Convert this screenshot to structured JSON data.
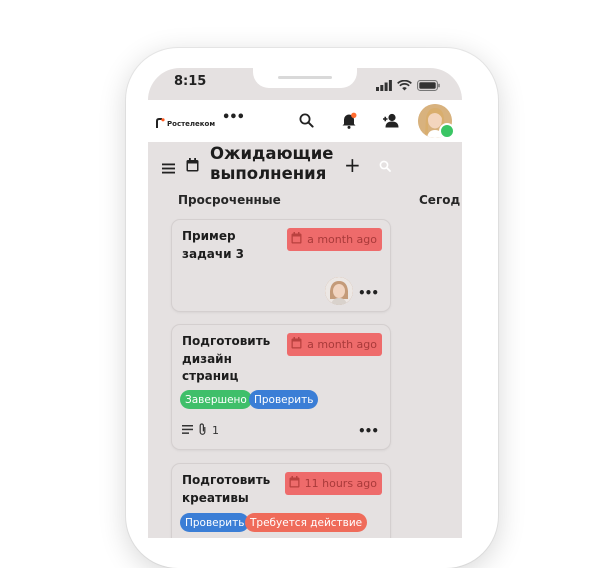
{
  "status_bar": {
    "time": "8:15"
  },
  "header": {
    "logo_text": "Ростелеком",
    "more_label": "•••"
  },
  "board": {
    "title": "Ожидающие выполнения",
    "add_label": "+"
  },
  "columns": [
    {
      "title": "Просроченные",
      "cards": [
        {
          "title": "Пример задачи 3",
          "due": "a month ago",
          "tags": [],
          "more": "•••"
        },
        {
          "title": "Подготовить дизайн страниц",
          "due": "a month ago",
          "tags": [
            {
              "label": "Завершено",
              "color": "#3fbf6a"
            },
            {
              "label": "Проверить",
              "color": "#3b7ed6"
            }
          ],
          "attachments": "1",
          "more": "•••"
        },
        {
          "title": "Подготовить креативы",
          "due": "11 hours ago",
          "tags": [
            {
              "label": "Проверить",
              "color": "#3b7ed6"
            },
            {
              "label": "Требуется действие",
              "color": "#ef6b5a"
            }
          ]
        }
      ]
    },
    {
      "title": "Сегод"
    }
  ],
  "colors": {
    "badge": "#ee6b6b",
    "badge_text": "#a93a3a",
    "screen_bg": "#e5e1e1",
    "online": "#3ac564"
  }
}
